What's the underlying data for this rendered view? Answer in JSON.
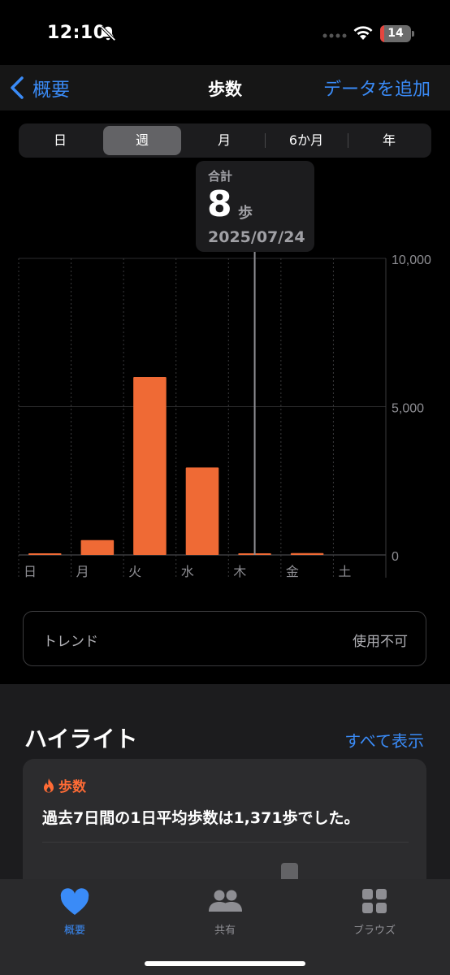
{
  "status_bar": {
    "time": "12:10",
    "battery": "14",
    "battery_level": 0.14
  },
  "nav": {
    "back_label": "概要",
    "title": "歩数",
    "add_data": "データを追加"
  },
  "segments": {
    "items": [
      "日",
      "週",
      "月",
      "6か月",
      "年"
    ],
    "selected": "週"
  },
  "tooltip": {
    "label": "合計",
    "value": "8",
    "unit": "歩",
    "date": "2025/07/24"
  },
  "chart_data": {
    "type": "bar",
    "categories": [
      "日",
      "月",
      "火",
      "水",
      "木",
      "金",
      "土"
    ],
    "values": [
      20,
      500,
      6000,
      2950,
      8,
      60,
      0
    ],
    "ylim": [
      0,
      10000
    ],
    "yticks": [
      "10,000",
      "5,000",
      "0"
    ],
    "ytick_values": [
      10000,
      5000,
      0
    ],
    "highlight_index": 4,
    "grid": true,
    "bar_color": "#ef6a35"
  },
  "trend": {
    "label": "トレンド",
    "value": "使用不可"
  },
  "highlights": {
    "title": "ハイライト",
    "show_all": "すべて表示",
    "card": {
      "category": "歩数",
      "text": "過去7日間の1日平均歩数は1,371歩でした。"
    }
  },
  "tabbar": {
    "items": [
      "概要",
      "共有",
      "ブラウズ"
    ],
    "active": "概要"
  },
  "colors": {
    "accent": "#3a8bf7",
    "orange": "#ff6b35",
    "bar": "#ef6a35"
  }
}
